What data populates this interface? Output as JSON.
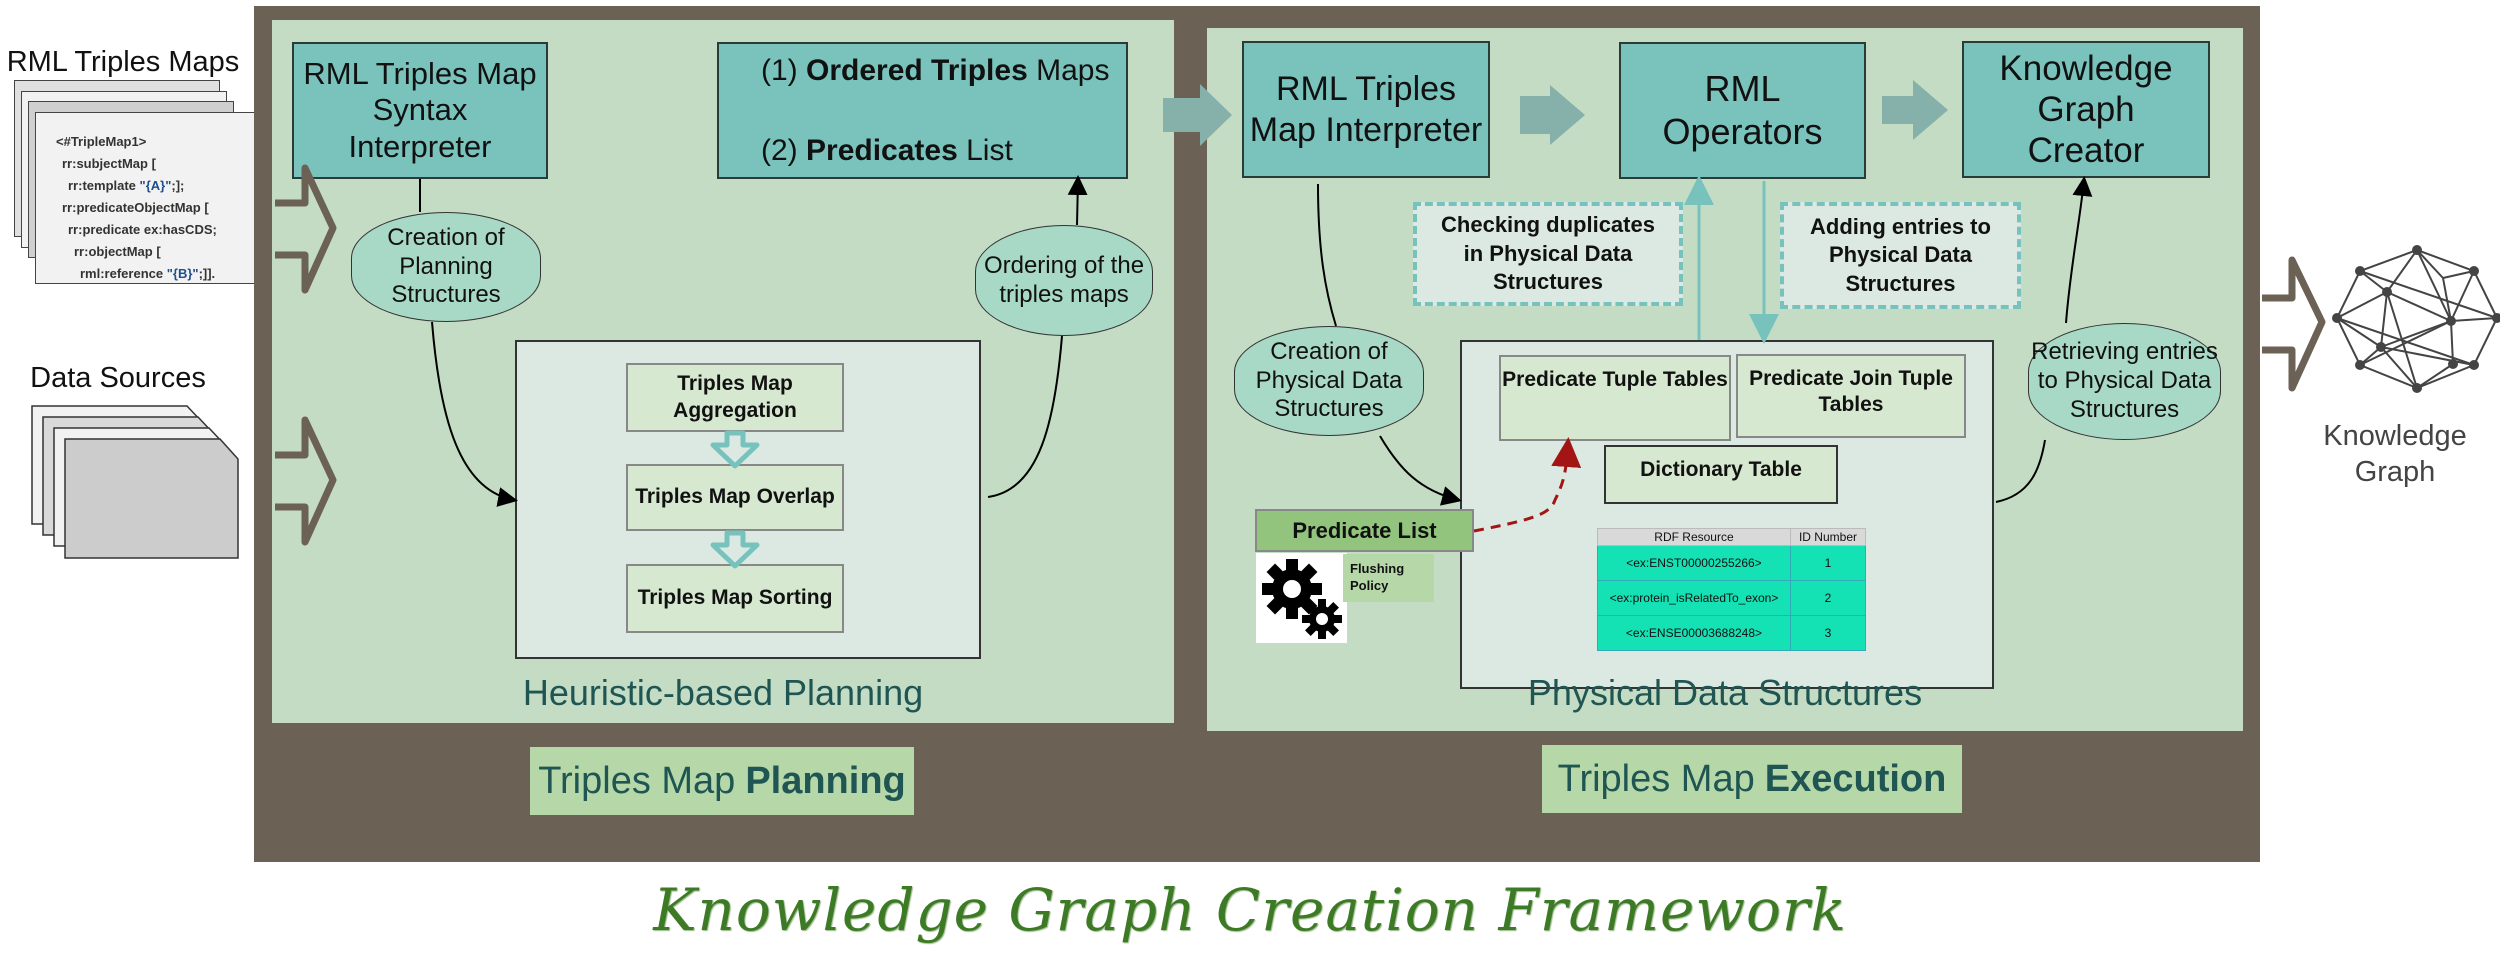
{
  "title": "Knowledge Graph Creation Framework",
  "inputs": {
    "triples_maps_label": "RML Triples Maps",
    "code_lines": [
      {
        "pre": "<#TripleMap1>",
        "indent": 0,
        "blue": "",
        "post": ""
      },
      {
        "pre": "rr:subjectMap [",
        "indent": 1,
        "blue": "",
        "post": ""
      },
      {
        "pre": "rr:template ",
        "indent": 2,
        "blue": "\"{A}\"",
        "post": ";];"
      },
      {
        "pre": "rr:predicateObjectMap [",
        "indent": 1,
        "blue": "",
        "post": ""
      },
      {
        "pre": "rr:predicate ex:hasCDS;",
        "indent": 2,
        "blue": "",
        "post": ""
      },
      {
        "pre": "rr:objectMap [",
        "indent": 3,
        "blue": "",
        "post": ""
      },
      {
        "pre": "rml:reference ",
        "indent": 4,
        "blue": "\"{B}\"",
        "post": ";]]."
      }
    ],
    "data_sources_label": "Data Sources"
  },
  "planning": {
    "syntax_interpreter": "RML Triples Map Syntax Interpreter",
    "output_line1_prefix": "(1)",
    "output_line1_bold": "Ordered Triples",
    "output_line1_suffix": "Maps",
    "output_line2_prefix": "(2)",
    "output_line2_bold": "Predicates",
    "output_line2_suffix": "List",
    "creation_planning": "Creation of Planning Structures",
    "ordering": "Ordering of the triples maps",
    "steps": [
      "Triples Map Aggregation",
      "Triples Map Overlap",
      "Triples Map Sorting"
    ],
    "subcaption": "Heuristic-based Planning",
    "caption_regular": "Triples Map",
    "caption_bold": "Planning"
  },
  "execution": {
    "interpreter": "RML Triples Map Interpreter",
    "operators": "RML Operators",
    "kg_creator": "Knowledge Graph Creator",
    "checking_duplicates": "Checking  duplicates in Physical Data Structures",
    "adding_entries": "Adding entries to Physical Data Structures",
    "creation_pds": "Creation of Physical Data Structures",
    "retrieving": "Retrieving entries to Physical Data Structures",
    "predicate_tuple_tables": "Predicate Tuple Tables",
    "predicate_join_tuple_tables": "Predicate Join Tuple Tables",
    "dictionary_table": "Dictionary Table",
    "predicate_list": "Predicate List",
    "flushing_policy": "Flushing Policy",
    "dict_headers": [
      "RDF Resource",
      "ID Number"
    ],
    "dict_rows": [
      [
        "<ex:ENST00000255266>",
        "1"
      ],
      [
        "<ex:protein_isRelatedTo_exon>",
        "2"
      ],
      [
        "<ex:ENSE00003688248>",
        "3"
      ]
    ],
    "subcaption": "Physical Data Structures",
    "caption_regular": "Triples Map",
    "caption_bold": "Execution"
  },
  "output": {
    "label": "Knowledge Graph"
  },
  "colors": {
    "frame": "#6b6155",
    "panel": "#c4dcc4",
    "teal_box": "#7ac3bd",
    "ellipse": "#a8d8c6",
    "caption_bg": "#b6d8a8",
    "caption_text": "#1f5552",
    "table_row": "#14e1b4",
    "title": "#3d7a25",
    "dashed_arrow": "#a31515"
  }
}
